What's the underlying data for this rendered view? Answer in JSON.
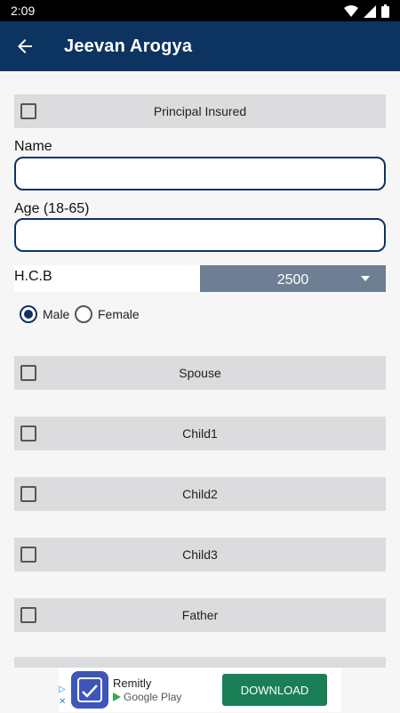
{
  "status_bar": {
    "time": "2:09"
  },
  "app_bar": {
    "title": "Jeevan Arogya"
  },
  "principal": {
    "label": "Principal Insured"
  },
  "form": {
    "name_label": "Name",
    "name_value": "",
    "age_label": "Age (18-65)",
    "age_value": "",
    "hcb_label": "H.C.B",
    "hcb_value": "2500",
    "gender": {
      "male": "Male",
      "female": "Female",
      "selected": "Male"
    }
  },
  "members": [
    {
      "label": "Spouse"
    },
    {
      "label": "Child1"
    },
    {
      "label": "Child2"
    },
    {
      "label": "Child3"
    },
    {
      "label": "Father"
    }
  ],
  "ad": {
    "brand": "Remitly",
    "store": "Google Play",
    "cta": "DOWNLOAD"
  },
  "colors": {
    "primary": "#0d3460",
    "row_bg": "#dcdcde",
    "dropdown_bg": "#6e7f94",
    "cta_bg": "#1a7f56"
  }
}
